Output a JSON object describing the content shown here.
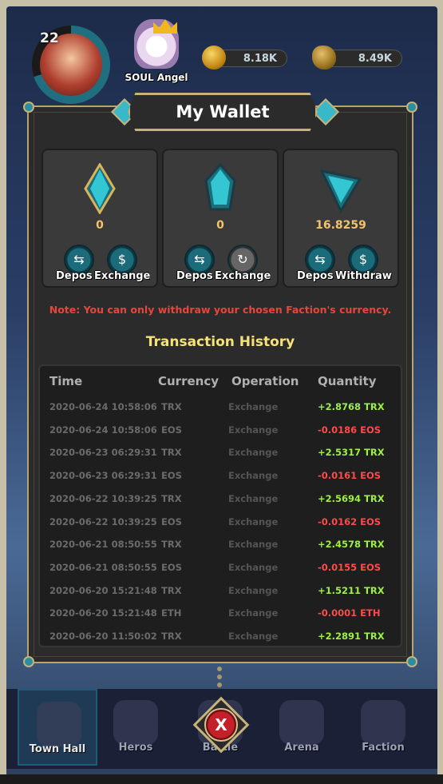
{
  "hud": {
    "level": "22",
    "hero_name": "SOUL Angel",
    "gold": "8.18K",
    "ore": "8.49K"
  },
  "wallet": {
    "title": "My Wallet",
    "currencies": [
      {
        "icon": "eos-gem-icon",
        "amount": "0",
        "buttons": [
          "Deposit",
          "Exchange"
        ],
        "labels": [
          "Depos",
          "Exchange"
        ],
        "color": "#2fb8c4"
      },
      {
        "icon": "eth-gem-icon",
        "amount": "0",
        "buttons": [
          "Deposit",
          "Exchange"
        ],
        "labels": [
          "Depos",
          "Exchange"
        ],
        "color": "#2fb8c4"
      },
      {
        "icon": "trx-gem-icon",
        "amount": "16.8259",
        "buttons": [
          "Deposit",
          "Withdraw"
        ],
        "labels": [
          "Depos",
          "Withdraw"
        ],
        "color": "#2fb8c4"
      }
    ],
    "note": "Note: You can only withdraw your chosen Faction's currency."
  },
  "history": {
    "title": "Transaction History",
    "columns": [
      "Time",
      "Currency",
      "Operation",
      "Quantity"
    ],
    "rows": [
      {
        "time": "2020-06-24 10:58:06",
        "currency": "TRX",
        "operation": "Exchange",
        "quantity": "+2.8768 TRX"
      },
      {
        "time": "2020-06-24 10:58:06",
        "currency": "EOS",
        "operation": "Exchange",
        "quantity": "-0.0186 EOS"
      },
      {
        "time": "2020-06-23 06:29:31",
        "currency": "TRX",
        "operation": "Exchange",
        "quantity": "+2.5317 TRX"
      },
      {
        "time": "2020-06-23 06:29:31",
        "currency": "EOS",
        "operation": "Exchange",
        "quantity": "-0.0161 EOS"
      },
      {
        "time": "2020-06-22 10:39:25",
        "currency": "TRX",
        "operation": "Exchange",
        "quantity": "+2.5694 TRX"
      },
      {
        "time": "2020-06-22 10:39:25",
        "currency": "EOS",
        "operation": "Exchange",
        "quantity": "-0.0162 EOS"
      },
      {
        "time": "2020-06-21 08:50:55",
        "currency": "TRX",
        "operation": "Exchange",
        "quantity": "+2.4578 TRX"
      },
      {
        "time": "2020-06-21 08:50:55",
        "currency": "EOS",
        "operation": "Exchange",
        "quantity": "-0.0155 EOS"
      },
      {
        "time": "2020-06-20 15:21:48",
        "currency": "TRX",
        "operation": "Exchange",
        "quantity": "+1.5211 TRX"
      },
      {
        "time": "2020-06-20 15:21:48",
        "currency": "ETH",
        "operation": "Exchange",
        "quantity": "-0.0001 ETH"
      },
      {
        "time": "2020-06-20 11:50:02",
        "currency": "TRX",
        "operation": "Exchange",
        "quantity": "+2.2891 TRX"
      }
    ]
  },
  "nav": {
    "items": [
      "Town Hall",
      "Heros",
      "Battle",
      "Arena",
      "Faction"
    ],
    "active": "Town Hall",
    "close_label": "X"
  },
  "colors": {
    "positive": "#9ef042",
    "negative": "#ff4a4a",
    "note": "#e9453a",
    "history_title": "#f6e27a",
    "amount": "#f2c46a"
  }
}
